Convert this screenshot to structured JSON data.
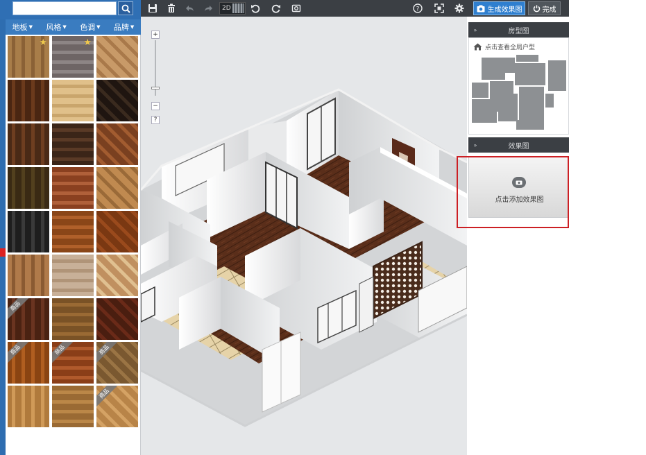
{
  "search": {
    "placeholder": ""
  },
  "filters": [
    {
      "label": "地板"
    },
    {
      "label": "风格"
    },
    {
      "label": "色调"
    },
    {
      "label": "品牌"
    }
  ],
  "swatches": [
    {
      "colors": [
        "#a87d49",
        "#8a6136"
      ],
      "star": true
    },
    {
      "colors": [
        "#6e6565",
        "#8d8585"
      ],
      "star": true
    },
    {
      "colors": [
        "#c89a68",
        "#a9794a"
      ]
    },
    {
      "colors": [
        "#4a2612",
        "#6b3a1c"
      ]
    },
    {
      "colors": [
        "#e0c08a",
        "#c9a56c"
      ]
    },
    {
      "colors": [
        "#1f1510",
        "#3a2a1e"
      ]
    },
    {
      "colors": [
        "#4a2a16",
        "#6e3e20"
      ]
    },
    {
      "colors": [
        "#3b2518",
        "#5a3a26"
      ]
    },
    {
      "colors": [
        "#7a4020",
        "#a25c30"
      ]
    },
    {
      "colors": [
        "#3a2a14",
        "#52401e"
      ]
    },
    {
      "colors": [
        "#8a4020",
        "#b0603a"
      ]
    },
    {
      "colors": [
        "#c08a50",
        "#9a6a38"
      ]
    },
    {
      "colors": [
        "#1e1e1e",
        "#3a3a3a"
      ]
    },
    {
      "colors": [
        "#8a4618",
        "#b0602a"
      ]
    },
    {
      "colors": [
        "#7a3812",
        "#9a4a1c"
      ]
    },
    {
      "colors": [
        "#b07a4a",
        "#8a5a32"
      ]
    },
    {
      "colors": [
        "#c8b098",
        "#b09478"
      ]
    },
    {
      "colors": [
        "#c09060",
        "#e0c090"
      ]
    },
    {
      "colors": [
        "#4a2212",
        "#6a3420"
      ],
      "tag": "商品"
    },
    {
      "colors": [
        "#7a5226",
        "#9a6a34"
      ]
    },
    {
      "colors": [
        "#4a1e10",
        "#6a2a18"
      ]
    },
    {
      "colors": [
        "#8a4412",
        "#b05e20"
      ],
      "tag": "商品"
    },
    {
      "colors": [
        "#8a3e18",
        "#b05a2c"
      ],
      "tag": "商品"
    },
    {
      "colors": [
        "#7a5830",
        "#9a7444"
      ],
      "tag": "商品"
    },
    {
      "colors": [
        "#b07a3c",
        "#d09a58"
      ]
    },
    {
      "colors": [
        "#9a6a34",
        "#bb8748"
      ]
    },
    {
      "colors": [
        "#b88448",
        "#d4a264"
      ],
      "tag": "商品"
    }
  ],
  "toolbar": {
    "view_mode_label": "2D",
    "render_label": "生成效果图",
    "done_label": "完成"
  },
  "zoom": {
    "plus": "+",
    "minus": "−",
    "help": "?"
  },
  "floor_plan_panel": {
    "title": "房型图",
    "link_text": "点击查看全局户型"
  },
  "render_panel": {
    "title": "效果图",
    "add_label": "点击添加效果图"
  },
  "colors": {
    "accent": "#2f7fcf",
    "toolbar": "#3b3f44",
    "highlight": "#cc1f24"
  }
}
